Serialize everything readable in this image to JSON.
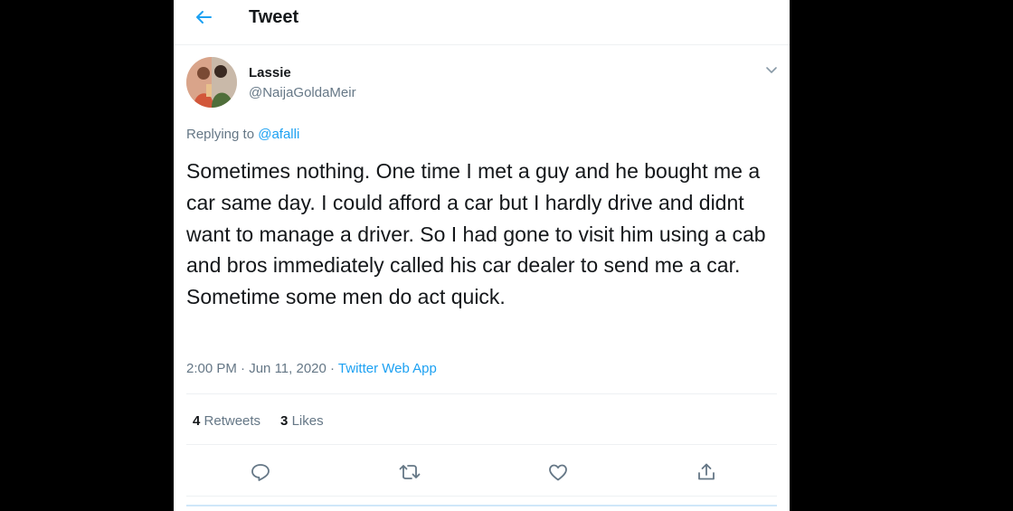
{
  "header": {
    "title": "Tweet",
    "back_icon": "arrow-left-icon",
    "accent": "#1da1f2"
  },
  "tweet": {
    "author_name": "Lassie",
    "author_handle": "@NaijaGoldaMeir",
    "replying_prefix": "Replying to",
    "replying_handle": "@afalli",
    "text": "Sometimes nothing. One time I met a guy and he bought me a car same day. I could afford a car but I hardly drive and didnt want to manage a driver. So I had gone to visit him using a cab and bros immediately called his car dealer to send me a car. Sometime some men do act quick.",
    "time": "2:00 PM",
    "date": "Jun 11, 2020",
    "source": "Twitter Web App"
  },
  "stats": {
    "retweets_count": "4",
    "retweets_label": "Retweets",
    "likes_count": "3",
    "likes_label": "Likes"
  },
  "actions": [
    "reply-icon",
    "retweet-icon",
    "like-icon",
    "share-icon"
  ]
}
